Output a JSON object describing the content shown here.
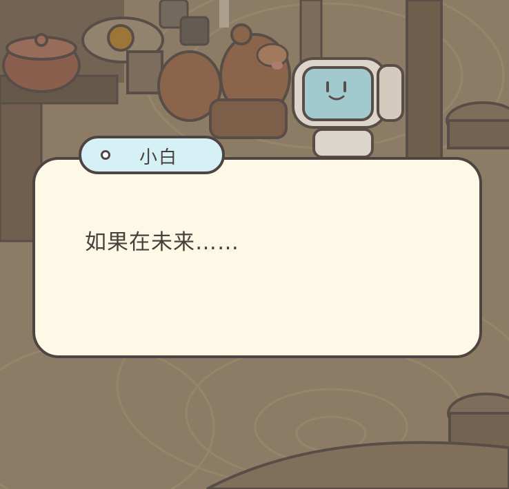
{
  "dialog": {
    "speaker_name": "小白",
    "text": "如果在未来……"
  },
  "colors": {
    "dialog_background": "#fdf9e6",
    "name_tag_background": "#d5f1f5",
    "outline": "#4f4442",
    "scene_dimmed": "#8b7a64"
  },
  "icons": {
    "name_tag_marker": "circle-dot-icon"
  }
}
